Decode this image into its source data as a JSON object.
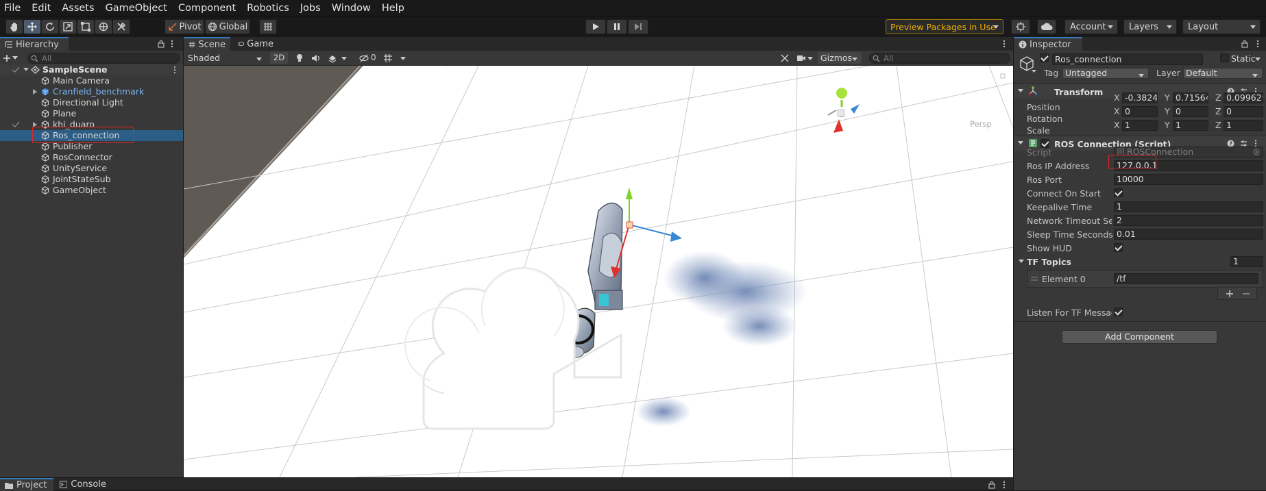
{
  "menu": [
    "File",
    "Edit",
    "Assets",
    "GameObject",
    "Component",
    "Robotics",
    "Jobs",
    "Window",
    "Help"
  ],
  "toolbar": {
    "pivot": "Pivot",
    "global": "Global",
    "preview_packages": "Preview Packages in Use",
    "account": "Account",
    "layers": "Layers",
    "layout": "Layout",
    "accent": "#f0b000"
  },
  "hierarchy": {
    "tab": "Hierarchy",
    "search_placeholder": "All",
    "scene_name": "SampleScene",
    "items": [
      {
        "label": "Main Camera",
        "type": "object"
      },
      {
        "label": "Cranfield_benchmark",
        "type": "prefab"
      },
      {
        "label": "Directional Light",
        "type": "object"
      },
      {
        "label": "Plane",
        "type": "object"
      },
      {
        "label": "khi_duaro",
        "type": "object"
      },
      {
        "label": "Ros_connection",
        "type": "object",
        "selected": true
      },
      {
        "label": "Publisher",
        "type": "object"
      },
      {
        "label": "RosConnector",
        "type": "object"
      },
      {
        "label": "UnityService",
        "type": "object"
      },
      {
        "label": "JointStateSub",
        "type": "object"
      },
      {
        "label": "GameObject",
        "type": "object"
      }
    ]
  },
  "scene": {
    "tabs": [
      "Scene",
      "Game"
    ],
    "shading_mode": "Shaded",
    "mode_2d": "2D",
    "hidden_count": "0",
    "gizmos": "Gizmos",
    "search_placeholder": "All",
    "view_label": "Persp"
  },
  "inspector": {
    "tab": "Inspector",
    "object_name": "Ros_connection",
    "static_label": "Static",
    "tag_label": "Tag",
    "tag_value": "Untagged",
    "layer_label": "Layer",
    "layer_value": "Default",
    "transform": {
      "title": "Transform",
      "position_label": "Position",
      "rotation_label": "Rotation",
      "scale_label": "Scale",
      "position": {
        "x": "-0.38241",
        "y": "0.715644",
        "z": "0.099629"
      },
      "rotation": {
        "x": "0",
        "y": "0",
        "z": "0"
      },
      "scale": {
        "x": "1",
        "y": "1",
        "z": "1"
      }
    },
    "ros": {
      "title": "ROS Connection (Script)",
      "script_label": "Script",
      "script_value": "ROSConnection",
      "ip_label": "Ros IP Address",
      "ip_value": "127.0.0.1",
      "port_label": "Ros Port",
      "port_value": "10000",
      "connect_label": "Connect On Start",
      "keepalive_label": "Keepalive Time",
      "keepalive_value": "1",
      "timeout_label": "Network Timeout Seconds",
      "timeout_value": "2",
      "sleep_label": "Sleep Time Seconds",
      "sleep_value": "0.01",
      "hud_label": "Show HUD",
      "tf_topics_label": "TF Topics",
      "tf_topics_count": "1",
      "element0_label": "Element 0",
      "element0_value": "/tf",
      "listen_label": "Listen For TF Messages"
    },
    "add_component": "Add Component"
  },
  "bottom_tabs": [
    "Project",
    "Console"
  ]
}
